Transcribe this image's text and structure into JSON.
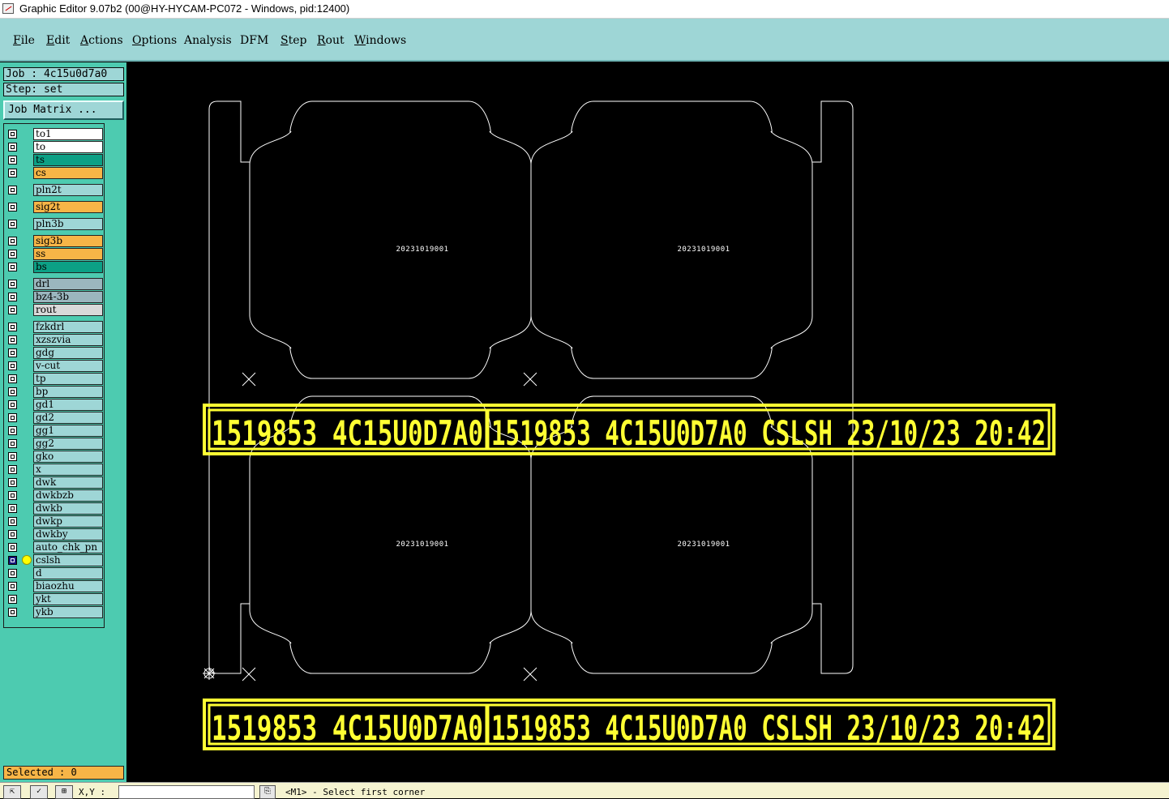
{
  "window": {
    "title": "Graphic Editor 9.07b2 (00@HY-HYCAM-PC072 - Windows, pid:12400)"
  },
  "menu": [
    {
      "pre": "",
      "key": "F",
      "rest": "ile"
    },
    {
      "pre": "",
      "key": "E",
      "rest": "dit"
    },
    {
      "pre": "",
      "key": "A",
      "rest": "ctions"
    },
    {
      "pre": "",
      "key": "O",
      "rest": "ptions"
    },
    {
      "pre": "Analysis",
      "key": "",
      "rest": ""
    },
    {
      "pre": "DFM",
      "key": "",
      "rest": ""
    },
    {
      "pre": "",
      "key": "S",
      "rest": "tep"
    },
    {
      "pre": "",
      "key": "R",
      "rest": "out"
    },
    {
      "pre": "",
      "key": "W",
      "rest": "indows"
    }
  ],
  "job": {
    "label": "Job : 4c15u0d7a0"
  },
  "step": {
    "label": "Step: set"
  },
  "job_matrix_label": "Job Matrix ...",
  "layers": [
    {
      "name": "to1",
      "color": "#ffffff"
    },
    {
      "name": "to",
      "color": "#ffffff"
    },
    {
      "name": "ts",
      "color": "#0ca085"
    },
    {
      "name": "cs",
      "color": "#f7b547"
    },
    {
      "name": "pln2t",
      "color": "#9ed6d6"
    },
    {
      "name": "sig2t",
      "color": "#f7b547"
    },
    {
      "name": "pln3b",
      "color": "#9ed6d6"
    },
    {
      "name": "sig3b",
      "color": "#f7b547"
    },
    {
      "name": "ss",
      "color": "#f7b547"
    },
    {
      "name": "bs",
      "color": "#0ca085"
    },
    {
      "name": "drl",
      "color": "#9bb6be"
    },
    {
      "name": "bz4-3b",
      "color": "#9bb6be"
    },
    {
      "name": "rout",
      "color": "#d9d9d9"
    },
    {
      "name": "fzkdrl",
      "color": "#9ed6d6"
    },
    {
      "name": "xzszvia",
      "color": "#9ed6d6"
    },
    {
      "name": "gdg",
      "color": "#9ed6d6"
    },
    {
      "name": "v-cut",
      "color": "#9ed6d6"
    },
    {
      "name": "tp",
      "color": "#9ed6d6"
    },
    {
      "name": "bp",
      "color": "#9ed6d6"
    },
    {
      "name": "gd1",
      "color": "#9ed6d6"
    },
    {
      "name": "gd2",
      "color": "#9ed6d6"
    },
    {
      "name": "gg1",
      "color": "#9ed6d6"
    },
    {
      "name": "gg2",
      "color": "#9ed6d6"
    },
    {
      "name": "gko",
      "color": "#9ed6d6"
    },
    {
      "name": "x",
      "color": "#9ed6d6"
    },
    {
      "name": "dwk",
      "color": "#9ed6d6"
    },
    {
      "name": "dwkbzb",
      "color": "#9ed6d6"
    },
    {
      "name": "dwkb",
      "color": "#9ed6d6"
    },
    {
      "name": "dwkp",
      "color": "#9ed6d6"
    },
    {
      "name": "dwkby",
      "color": "#9ed6d6"
    },
    {
      "name": "auto_chk_pn",
      "color": "#9ed6d6"
    },
    {
      "name": "cslsh",
      "color": "#9ed6d6",
      "active": true
    },
    {
      "name": "d",
      "color": "#9ed6d6"
    },
    {
      "name": "biaozhu",
      "color": "#9ed6d6"
    },
    {
      "name": "ykt",
      "color": "#9ed6d6"
    },
    {
      "name": "ykb",
      "color": "#9ed6d6"
    }
  ],
  "selected_label": "Selected : 0",
  "panel_text": "20231019001",
  "stamp": {
    "part1": "1519853   4C15U0D7A0",
    "part2": "1519853   4C15U0D7A0 CSLSH 23/10/23 20:42"
  },
  "colors": {
    "stamp": "#ffff33",
    "outline": "#ffffff",
    "canvas": "#000000"
  },
  "statusbar": {
    "xy_label": "X,Y :",
    "prompt": "<M1> - Select first corner"
  },
  "icons": [
    "app-icon",
    "zoom-icon",
    "check-icon",
    "grid-icon",
    "origin-icon"
  ]
}
